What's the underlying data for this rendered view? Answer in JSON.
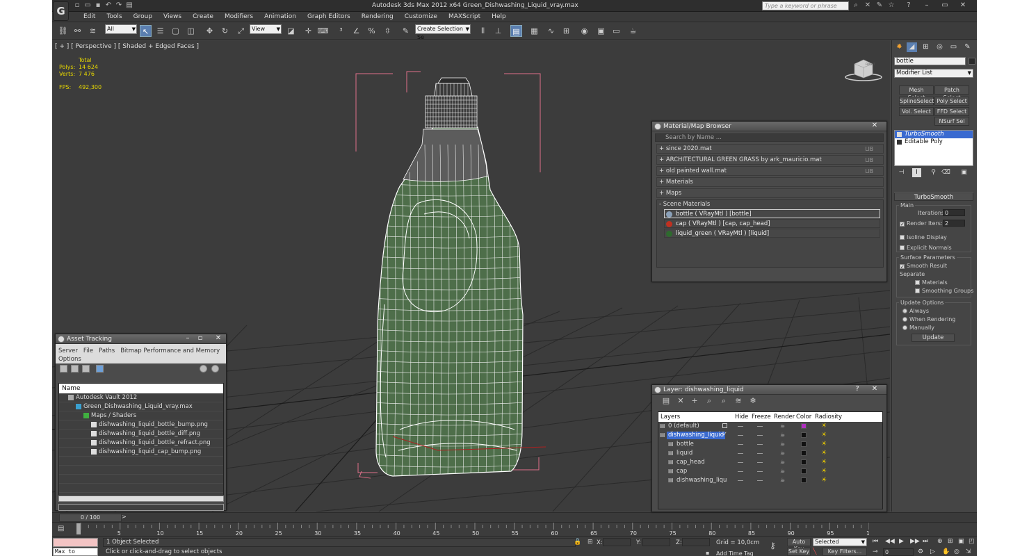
{
  "app": {
    "title": "Autodesk 3ds Max  2012 x64     Green_Dishwashing_Liquid_vray.max",
    "logo_text": "G",
    "search_placeholder": "Type a keyword or phrase",
    "accent": "#5b7fb0"
  },
  "menus": [
    "Edit",
    "Tools",
    "Group",
    "Views",
    "Create",
    "Modifiers",
    "Animation",
    "Graph Editors",
    "Rendering",
    "Customize",
    "MAXScript",
    "Help"
  ],
  "toolbar": {
    "selection_filter": "All",
    "ref_coord": "View",
    "named_selection": "Create Selection Se"
  },
  "viewport": {
    "label": "[ + ] [ Perspective ] [ Shaded + Edged Faces ]",
    "stats_header": "Total",
    "stats": [
      {
        "k": "Polys:",
        "v": "14 624"
      },
      {
        "k": "Verts:",
        "v": "7 476"
      }
    ],
    "fps_label": "FPS:",
    "fps_value": "492,300",
    "viewcube_face": "FRONT",
    "model_color": "#4e6e4a",
    "wire_color": "#ffffff",
    "bbox_color": "#e0708a"
  },
  "asset_tracking": {
    "title": "Asset Tracking",
    "menu": [
      "Server",
      "File",
      "Paths",
      "Bitmap Performance and Memory"
    ],
    "menu2": "Options",
    "column": "Name",
    "rows": [
      {
        "label": "Autodesk Vault 2012",
        "indent": 1
      },
      {
        "label": "Green_Dishwashing_Liquid_vray.max",
        "indent": 2
      },
      {
        "label": "Maps / Shaders",
        "indent": 3
      },
      {
        "label": "dishwashing_liquid_bottle_bump.png",
        "indent": 4
      },
      {
        "label": "dishwashing_liquid_bottle_diff.png",
        "indent": 4
      },
      {
        "label": "dishwashing_liquid_bottle_refract.png",
        "indent": 4
      },
      {
        "label": "dishwashing_liquid_cap_bump.png",
        "indent": 4
      }
    ]
  },
  "material_browser": {
    "title": "Material/Map Browser",
    "search": "Search by Name ...",
    "libs": [
      {
        "label": "+ since 2020.mat",
        "tag": "LIB"
      },
      {
        "label": "+ ARCHITECTURAL GREEN GRASS by ark_mauricio.mat",
        "tag": "LIB"
      },
      {
        "label": "+ old painted wall.mat",
        "tag": "LIB"
      },
      {
        "label": "+ Materials",
        "tag": ""
      },
      {
        "label": "+ Maps",
        "tag": ""
      }
    ],
    "scene_header": "- Scene Materials",
    "scene": [
      {
        "label": "bottle  ( VRayMtl ) [bottle]",
        "color": "#8aa0b8"
      },
      {
        "label": "cap  ( VRayMtl ) [cap, cap_head]",
        "color": "#c03020"
      },
      {
        "label": "liquid_green  ( VRayMtl ) [liquid]",
        "color": "#2e6a2e"
      }
    ]
  },
  "layers": {
    "title": "Layer: dishwashing_liquid",
    "cols": {
      "layers": "Layers",
      "hide": "Hide",
      "freeze": "Freeze",
      "render": "Render",
      "color": "Color",
      "radiosity": "Radiosity"
    },
    "rows": [
      {
        "label": "0 (default)",
        "indent": 0,
        "sel": false,
        "color": "#b030c0"
      },
      {
        "label": "dishwashing_liquid",
        "indent": 0,
        "sel": true,
        "color": "#111111"
      },
      {
        "label": "bottle",
        "indent": 1,
        "sel": false,
        "color": "#111111"
      },
      {
        "label": "liquid",
        "indent": 1,
        "sel": false,
        "color": "#111111"
      },
      {
        "label": "cap_head",
        "indent": 1,
        "sel": false,
        "color": "#111111"
      },
      {
        "label": "cap",
        "indent": 1,
        "sel": false,
        "color": "#111111"
      },
      {
        "label": "dishwashing_liqu",
        "indent": 1,
        "sel": false,
        "color": "#111111"
      }
    ]
  },
  "command_panel": {
    "object_name": "bottle",
    "modifier_list": "Modifier List",
    "mod_buttons": [
      "Mesh Select",
      "Patch Select",
      "SplineSelect",
      "Poly Select",
      "Vol. Select",
      "FFD Select",
      "NSurf Sel"
    ],
    "stack": [
      "TurboSmooth",
      "Editable Poly"
    ],
    "rollout_title": "TurboSmooth",
    "main_group": "Main",
    "iterations_label": "Iterations:",
    "iterations": "0",
    "render_iters_label": "Render Iters:",
    "render_iters": "2",
    "isoline": "Isoline Display",
    "explicit_normals": "Explicit Normals",
    "surface_group": "Surface Parameters",
    "smooth_result": "Smooth Result",
    "separate": "Separate",
    "sep_materials": "Materials",
    "sep_smoothing": "Smoothing Groups",
    "update_group": "Update Options",
    "always": "Always",
    "when_rendering": "When Rendering",
    "manually": "Manually",
    "update_button": "Update"
  },
  "timeline": {
    "frame": "0 / 100",
    "ticks": [
      "5",
      "10",
      "15",
      "20",
      "25",
      "30",
      "35",
      "40",
      "45",
      "50",
      "55",
      "60",
      "65",
      "70",
      "75",
      "80",
      "85",
      "90",
      "95",
      "100"
    ]
  },
  "status": {
    "maxscript": "Max to Physc.",
    "selected": "1 Object Selected",
    "prompt": "Click or click-and-drag to select objects",
    "x": "X:",
    "y": "Y:",
    "z": "Z:",
    "grid": "Grid = 10,0cm",
    "add_time_tag": "Add Time Tag",
    "auto_key": "Auto Key",
    "set_key": "Set Key",
    "selected_dd": "Selected",
    "key_filters": "Key Filters...",
    "frame_field": "0"
  }
}
